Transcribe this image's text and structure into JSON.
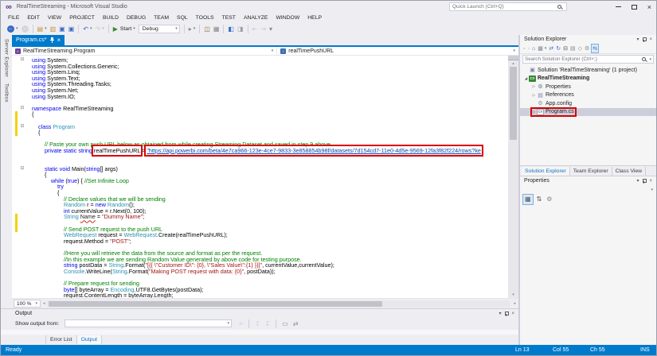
{
  "window": {
    "title": "RealTimeStreaming - Microsoft Visual Studio",
    "quick_launch_placeholder": "Quick Launch (Ctrl+Q)"
  },
  "icons": {
    "dropdown": "▾",
    "close": "×",
    "up": "▴",
    "down": "▾",
    "left": "◂",
    "right": "▸"
  },
  "colors": {
    "accent_blue": "#007ACC",
    "annotation_red": "#DA0000",
    "keyword_blue": "#0000EE",
    "type_teal": "#2B91AF",
    "string_maroon": "#A31515",
    "comment_green": "#008000",
    "link_blue": "#0645AD",
    "modified_yellow": "#F2D109",
    "logo_purple": "#5C2D91",
    "selection_gray": "#CCCEDB"
  },
  "menu": {
    "items": [
      "FILE",
      "EDIT",
      "VIEW",
      "PROJECT",
      "BUILD",
      "DEBUG",
      "TEAM",
      "SQL",
      "TOOLS",
      "TEST",
      "ANALYZE",
      "WINDOW",
      "HELP"
    ]
  },
  "toolbar": {
    "items": [
      {
        "name": "nav-backward-icon",
        "ch": "←",
        "circle": true,
        "dropdown": true
      },
      {
        "name": "nav-forward-icon",
        "ch": "→",
        "circle": true,
        "disabled": true
      },
      {
        "sep": true
      },
      {
        "name": "new-project-icon",
        "ch": "▤",
        "color": "#C7913B",
        "dropdown": true
      },
      {
        "name": "open-file-icon",
        "ch": "▥",
        "color": "#C7913B"
      },
      {
        "name": "save-icon",
        "ch": "▣",
        "color": "#3A6BC6"
      },
      {
        "name": "save-all-icon",
        "ch": "▣",
        "color": "#3A6BC6"
      },
      {
        "sep": true
      },
      {
        "name": "undo-icon",
        "ch": "↶",
        "color": "#3A6BC6",
        "dropdown": true
      },
      {
        "name": "redo-icon",
        "ch": "↷",
        "color": "#9AA0A8",
        "disabled": true,
        "dropdown": true
      },
      {
        "sep": true
      },
      {
        "name": "start-debug-button",
        "ch": "▶",
        "color": "#388934",
        "label": "Start",
        "dropdown": true
      },
      {
        "name": "solution-configurations-select",
        "combo": "Debug"
      },
      {
        "sep": true
      },
      {
        "name": "attach-to-process-icon",
        "ch": "▸",
        "color": "#888",
        "dropdown": true
      },
      {
        "sep": true
      },
      {
        "name": "find-in-files-icon",
        "ch": "◫",
        "color": "#8a6d3b"
      },
      {
        "name": "command-window-icon",
        "ch": "▦",
        "color": "#888"
      },
      {
        "sep": true
      },
      {
        "name": "comment-lines-icon",
        "ch": "◧",
        "color": "#3A6BC6"
      },
      {
        "name": "uncomment-lines-icon",
        "ch": "◨",
        "color": "#9AA0A8"
      },
      {
        "sep": true
      },
      {
        "name": "decrease-indent-icon",
        "ch": "⇤",
        "color": "#9AA0A8",
        "disabled": true
      },
      {
        "name": "increase-indent-icon",
        "ch": "⇥",
        "color": "#9AA0A8",
        "disabled": true
      },
      {
        "name": "toolbar-overflow-icon",
        "ch": "▾",
        "color": "#888"
      }
    ]
  },
  "side_strip": {
    "tabs": [
      {
        "name": "side-tab-server-explorer",
        "label": "Server Explorer"
      },
      {
        "name": "side-tab-toolbox",
        "label": "Toolbox"
      }
    ]
  },
  "editor": {
    "tab": {
      "label": "Program.cs*"
    },
    "breadcrumb": {
      "type_name": "RealTimeStreaming.Program",
      "member_name": "realTimePushURL"
    },
    "zoom_level": "100 %",
    "lines": [
      {
        "f": 1,
        "t": [
          [
            "k",
            "using"
          ],
          [
            "p",
            " System;"
          ]
        ]
      },
      {
        "t": [
          [
            "k",
            "using"
          ],
          [
            "p",
            " System.Collections.Generic;"
          ]
        ]
      },
      {
        "t": [
          [
            "k",
            "using"
          ],
          [
            "p",
            " System.Linq;"
          ]
        ]
      },
      {
        "t": [
          [
            "k",
            "using"
          ],
          [
            "p",
            " System.Text;"
          ]
        ]
      },
      {
        "t": [
          [
            "k",
            "using"
          ],
          [
            "p",
            " System.Threading.Tasks;"
          ]
        ]
      },
      {
        "t": [
          [
            "k",
            "using"
          ],
          [
            "p",
            " System.Net;"
          ]
        ]
      },
      {
        "t": [
          [
            "k",
            "using"
          ],
          [
            "p",
            " System.IO;"
          ]
        ]
      },
      {
        "t": []
      },
      {
        "f": 1,
        "t": [
          [
            "k",
            "namespace"
          ],
          [
            "p",
            " RealTimeStreaming"
          ]
        ]
      },
      {
        "m": 1,
        "t": [
          [
            "p",
            "{"
          ]
        ]
      },
      {
        "m": 1,
        "t": []
      },
      {
        "m": 1,
        "f": 1,
        "t": [
          [
            "p",
            "    "
          ],
          [
            "k",
            "class"
          ],
          [
            "p",
            " "
          ],
          [
            "t",
            "Program"
          ]
        ]
      },
      {
        "m": 1,
        "t": [
          [
            "p",
            "    {"
          ]
        ]
      },
      {
        "t": []
      },
      {
        "t": [
          [
            "c",
            "        // Paste your own push URL below as obtained from while creating Streaming Dataset and saved in step 9 above"
          ]
        ]
      },
      {
        "t": [
          [
            "p",
            "        "
          ],
          [
            "k",
            "private"
          ],
          [
            "p",
            " "
          ],
          [
            "k",
            "static"
          ],
          [
            "p",
            " "
          ],
          [
            "k",
            "string"
          ],
          [
            "p",
            " "
          ],
          [
            "p box",
            "realTimePushURL",
            "push-url-variable-annotation"
          ],
          [
            "p",
            " = "
          ],
          [
            "u box",
            "\"https://api.powerbi.com/beta/4e7ca966-123e-4ce7-9833-3e858854b98f/datasets/7d154cd7-11e0-4d5e-9569-12fa3f82f224/rows?ke",
            "push-url-link-annotation"
          ]
        ]
      },
      {
        "t": []
      },
      {
        "t": []
      },
      {
        "f": 1,
        "t": [
          [
            "p",
            "        "
          ],
          [
            "k",
            "static"
          ],
          [
            "p",
            " "
          ],
          [
            "k",
            "void"
          ],
          [
            "p",
            " Main("
          ],
          [
            "k",
            "string"
          ],
          [
            "p",
            "[] args)"
          ]
        ]
      },
      {
        "t": [
          [
            "p",
            "        {"
          ]
        ]
      },
      {
        "t": [
          [
            "p",
            "            "
          ],
          [
            "k",
            "while"
          ],
          [
            "p",
            " ("
          ],
          [
            "k",
            "true"
          ],
          [
            "p",
            ") { "
          ],
          [
            "c",
            "//Set Infinite Loop"
          ]
        ]
      },
      {
        "t": [
          [
            "p",
            "                "
          ],
          [
            "k",
            "try"
          ]
        ]
      },
      {
        "t": [
          [
            "p",
            "                {"
          ]
        ]
      },
      {
        "t": [
          [
            "c",
            "                    // Declare values that we will be sending"
          ]
        ]
      },
      {
        "t": [
          [
            "p",
            "                    "
          ],
          [
            "t",
            "Random"
          ],
          [
            "p",
            " r = "
          ],
          [
            "k",
            "new"
          ],
          [
            "p",
            " "
          ],
          [
            "t",
            "Random"
          ],
          [
            "p",
            "();"
          ]
        ]
      },
      {
        "t": [
          [
            "p",
            "                    "
          ],
          [
            "k",
            "int"
          ],
          [
            "p",
            " currentValue = r.Next(0, 100);"
          ]
        ]
      },
      {
        "m": 1,
        "t": [
          [
            "p",
            "                    "
          ],
          [
            "t",
            "String"
          ],
          [
            "p",
            " "
          ],
          [
            "w",
            "Name"
          ],
          [
            "p",
            " = "
          ],
          [
            "s",
            "\"Dummy Name\""
          ],
          [
            "p",
            ";"
          ]
        ]
      },
      {
        "m": 1,
        "t": []
      },
      {
        "m": 1,
        "t": [
          [
            "c",
            "                    // Send POST request to the push URL"
          ]
        ]
      },
      {
        "t": [
          [
            "p",
            "                    "
          ],
          [
            "t",
            "WebRequest"
          ],
          [
            "p",
            " request = "
          ],
          [
            "t",
            "WebRequest"
          ],
          [
            "p",
            ".Create(realTimePushURL);"
          ]
        ]
      },
      {
        "t": [
          [
            "p",
            "                    request.Method = "
          ],
          [
            "s",
            "\"POST\""
          ],
          [
            "p",
            ";"
          ]
        ]
      },
      {
        "t": []
      },
      {
        "t": [
          [
            "c",
            "                    //Here you will retrieve the data from the source and format as per the request."
          ]
        ]
      },
      {
        "t": [
          [
            "c",
            "                    //In this example we are sending Random Value generated by above code for testing purpose."
          ]
        ]
      },
      {
        "t": [
          [
            "p",
            "                    "
          ],
          [
            "k",
            "string"
          ],
          [
            "p",
            " postData = "
          ],
          [
            "t",
            "String"
          ],
          [
            "p",
            ".Format("
          ],
          [
            "s",
            "\"[{{ \\\"Customer ID\\\": {0}, \\\"Sales Value\\\":{1} }}]\""
          ],
          [
            "p",
            ", currentValue,currentValue);"
          ]
        ]
      },
      {
        "t": [
          [
            "p",
            "                    "
          ],
          [
            "t",
            "Console"
          ],
          [
            "p",
            ".WriteLine("
          ],
          [
            "t",
            "String"
          ],
          [
            "p",
            ".Format("
          ],
          [
            "s",
            "\"Making POST request with data: {0}\""
          ],
          [
            "p",
            ", postData));"
          ]
        ]
      },
      {
        "t": []
      },
      {
        "t": [
          [
            "c",
            "                    // Prepare request for sending"
          ]
        ]
      },
      {
        "t": [
          [
            "p",
            "                    "
          ],
          [
            "k",
            "byte"
          ],
          [
            "p",
            "[] byteArray = "
          ],
          [
            "t",
            "Encoding"
          ],
          [
            "p",
            ".UTF8.GetBytes(postData);"
          ]
        ]
      },
      {
        "t": [
          [
            "p",
            "                    request.ContentLength = byteArray.Length;"
          ]
        ]
      }
    ]
  },
  "solution_explorer": {
    "title": "Solution Explorer",
    "search_placeholder": "Search Solution Explorer (Ctrl+;)",
    "toolbar": [
      {
        "name": "se-back-icon",
        "ch": "◦",
        "color": "#888"
      },
      {
        "name": "se-forward-icon",
        "ch": "◦",
        "color": "#bbb"
      },
      {
        "name": "se-home-icon",
        "ch": "⌂",
        "color": "#3A6BC6"
      },
      {
        "name": "se-switch-views-icon",
        "ch": "▩",
        "color": "#888",
        "dropdown": true
      },
      {
        "name": "se-pending-changes-icon",
        "ch": "⇄",
        "color": "#3A6BC6"
      },
      {
        "name": "se-refresh-icon",
        "ch": "↻",
        "color": "#3A6BC6"
      },
      {
        "name": "se-collapse-all-icon",
        "ch": "⊟",
        "color": "#555"
      },
      {
        "name": "se-show-all-files-icon",
        "ch": "▤",
        "color": "#888"
      },
      {
        "name": "se-view-code-icon",
        "ch": "◇",
        "color": "#888"
      },
      {
        "name": "se-properties-icon",
        "ch": "⚙",
        "color": "#888"
      },
      {
        "name": "se-sync-with-active-doc-icon",
        "ch": "⇆",
        "color": "#3A6BC6",
        "boxed": true
      }
    ],
    "tree": [
      {
        "name": "tree-item-solution",
        "ic": "sln",
        "label": "Solution 'RealTimeStreaming' (1 project)",
        "indent": 0
      },
      {
        "name": "tree-item-project-realtimestreaming",
        "ic": "csproj",
        "label": "RealTimeStreaming",
        "indent": 0,
        "exp": "open",
        "bold": true
      },
      {
        "name": "tree-item-properties",
        "ic": "props",
        "label": "Properties",
        "indent": 1,
        "exp": "closed"
      },
      {
        "name": "tree-item-references",
        "ic": "refs",
        "label": "References",
        "indent": 1,
        "exp": "closed"
      },
      {
        "name": "tree-item-appconfig",
        "ic": "config",
        "label": "App.config",
        "indent": 1
      },
      {
        "name": "tree-item-programcs",
        "ic": "csfile",
        "label": "Program.cs",
        "indent": 1,
        "exp": "closed",
        "selected": true,
        "redbox": true
      }
    ]
  },
  "dock_tabs": [
    {
      "name": "dock-tab-solution-explorer",
      "label": "Solution Explorer",
      "active": true
    },
    {
      "name": "dock-tab-team-explorer",
      "label": "Team Explorer"
    },
    {
      "name": "dock-tab-class-view",
      "label": "Class View"
    }
  ],
  "properties": {
    "title": "Properties",
    "toolbar": [
      {
        "name": "props-categorized-icon",
        "ch": "▦",
        "color": "#555",
        "boxed": true
      },
      {
        "name": "props-alphabetical-icon",
        "ch": "⇅",
        "color": "#555"
      },
      {
        "name": "props-property-pages-icon",
        "ch": "⚙",
        "color": "#888"
      }
    ]
  },
  "output": {
    "title": "Output",
    "show_output_from_label": "Show output from:",
    "icons": [
      {
        "name": "output-messages-icon",
        "ch": "≡",
        "color": "#A8ABB2",
        "disabled": true
      },
      {
        "sep": true
      },
      {
        "name": "output-prev-message-icon",
        "ch": "↥",
        "color": "#A8ABB2",
        "disabled": true
      },
      {
        "name": "output-next-message-icon",
        "ch": "↧",
        "color": "#A8ABB2",
        "disabled": true
      },
      {
        "sep": true
      },
      {
        "name": "output-clear-all-icon",
        "ch": "▭",
        "color": "#888"
      },
      {
        "name": "output-word-wrap-icon",
        "ch": "⇄",
        "color": "#888"
      }
    ]
  },
  "bottom_tabs": [
    {
      "name": "bottom-tab-error-list",
      "label": "Error List"
    },
    {
      "name": "bottom-tab-output",
      "label": "Output",
      "active": true
    }
  ],
  "status_bar": {
    "ready": "Ready",
    "line": "Ln 13",
    "column": "Col 55",
    "character": "Ch 55",
    "mode": "INS"
  }
}
